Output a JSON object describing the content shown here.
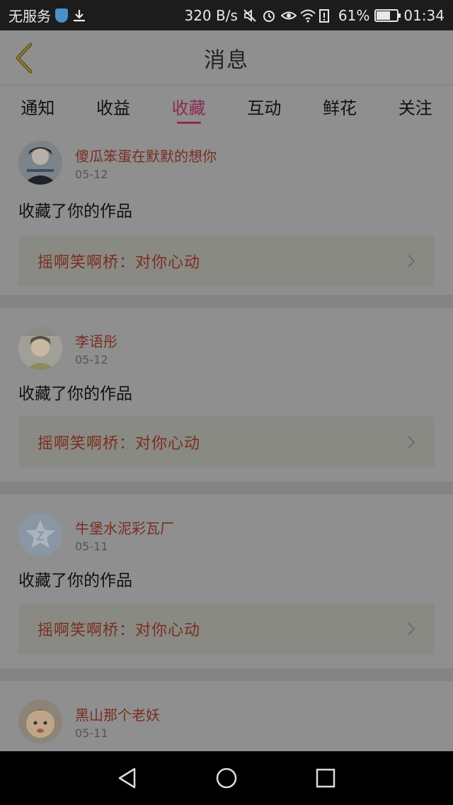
{
  "status_bar": {
    "carrier": "无服务",
    "net_speed": "320 B/s",
    "battery": "61%",
    "battery_level": 0.61,
    "time": "01:34"
  },
  "header": {
    "title": "消息"
  },
  "tabs": [
    {
      "label": "通知",
      "active": false
    },
    {
      "label": "收益",
      "active": false
    },
    {
      "label": "收藏",
      "active": true
    },
    {
      "label": "互动",
      "active": false
    },
    {
      "label": "鲜花",
      "active": false
    },
    {
      "label": "关注",
      "active": false
    }
  ],
  "items": [
    {
      "username": "傻瓜笨蛋在默默的想你",
      "date": "05-12",
      "action": "收藏了你的作品",
      "work": "摇啊笑啊桥：对你心动"
    },
    {
      "username": "李语彤",
      "date": "05-12",
      "action": "收藏了你的作品",
      "work": "摇啊笑啊桥：对你心动"
    },
    {
      "username": "牛堡水泥彩瓦厂",
      "date": "05-11",
      "action": "收藏了你的作品",
      "work": "摇啊笑啊桥：对你心动"
    },
    {
      "username": "黑山那个老妖",
      "date": "05-11"
    }
  ],
  "colors": {
    "accent": "#8c2a52",
    "username": "#7a2d1f",
    "overlay_bg": "#8f8f8f"
  }
}
